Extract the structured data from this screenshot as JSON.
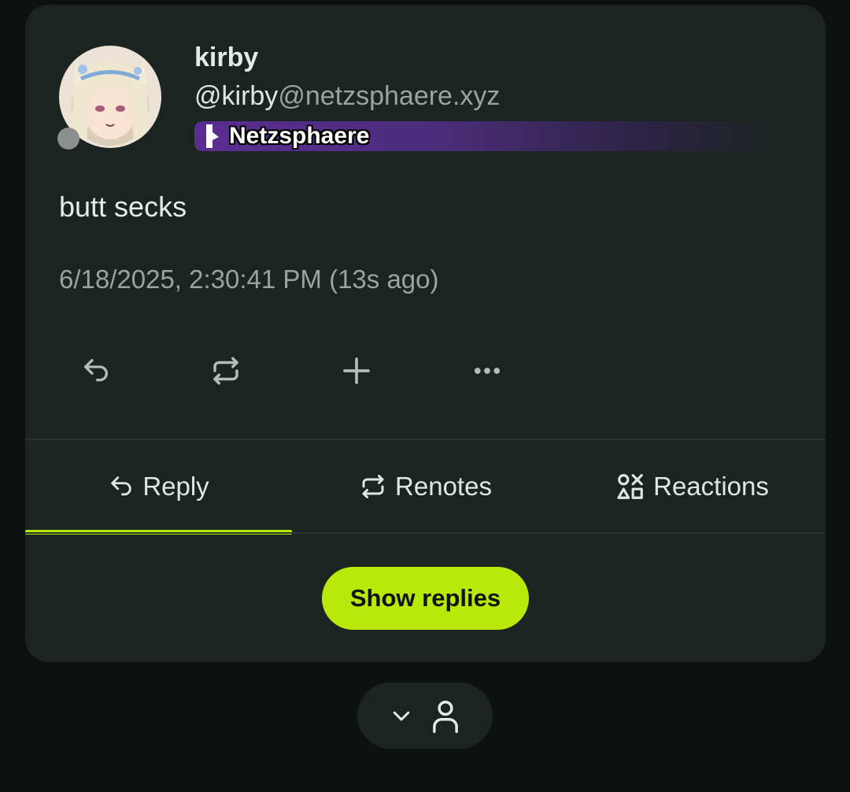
{
  "note": {
    "display_name": "kirby",
    "handle_user": "@kirby",
    "handle_host": "@netzsphaere.xyz",
    "instance_name": "Netzsphaere",
    "text": "butt secks",
    "timestamp": "6/18/2025, 2:30:41 PM (13s ago)"
  },
  "actions": {
    "reply_icon": "reply-icon",
    "renote_icon": "renote-icon",
    "react_icon": "plus-icon",
    "more_icon": "more-icon"
  },
  "tabs": [
    {
      "label": "Reply",
      "icon": "reply-icon",
      "active": true
    },
    {
      "label": "Renotes",
      "icon": "renote-icon",
      "active": false
    },
    {
      "label": "Reactions",
      "icon": "reactions-icon",
      "active": false
    }
  ],
  "show_replies_label": "Show replies",
  "colors": {
    "accent": "#b9e80b",
    "card_bg": "#1c2422",
    "page_bg": "#0d1211",
    "instance_badge": "#5b2d91"
  }
}
